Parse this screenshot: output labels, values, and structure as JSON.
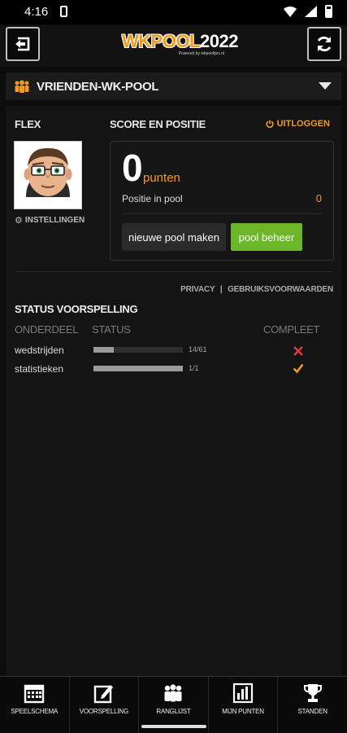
{
  "status_bar": {
    "time": "4:16"
  },
  "header": {
    "logo_part1": "WKPOOL",
    "logo_part2": "2022",
    "logo_sub": "Powered by wkpoeltjes.nl"
  },
  "pool": {
    "name": "VRIENDEN-WK-POOL"
  },
  "user": {
    "name": "FLEX",
    "settings_label": "INSTELLINGEN"
  },
  "score": {
    "section_title": "SCORE EN POSITIE",
    "logout_label": "UITLOGGEN",
    "points": "0",
    "points_unit": "punten",
    "position_label": "Positie in pool",
    "position_value": "0",
    "new_pool_label": "nieuwe pool maken",
    "manage_pool_label": "pool beheer"
  },
  "links": {
    "privacy": "PRIVACY",
    "separator": "|",
    "terms": "GEBRUIKSVOORWAARDEN"
  },
  "prediction_status": {
    "title": "STATUS VOORSPELLING",
    "columns": [
      "ONDERDEEL",
      "STATUS",
      "COMPLEET"
    ],
    "rows": [
      {
        "label": "wedstrijden",
        "progress_text": "14/61",
        "progress": 0.23,
        "complete": false
      },
      {
        "label": "statistieken",
        "progress_text": "1/1",
        "progress": 1.0,
        "complete": true
      }
    ]
  },
  "bottom_nav": [
    {
      "label": "SPEELSCHEMA",
      "icon": "calendar-icon"
    },
    {
      "label": "VOORSPELLING",
      "icon": "edit-icon"
    },
    {
      "label": "RANGLIJST",
      "icon": "users-icon"
    },
    {
      "label": "MIJN PUNTEN",
      "icon": "bar-chart-icon"
    },
    {
      "label": "STANDEN",
      "icon": "trophy-icon"
    }
  ],
  "colors": {
    "accent": "#f39a1e",
    "green": "#6cb62a",
    "cross": "#e33b3b"
  }
}
